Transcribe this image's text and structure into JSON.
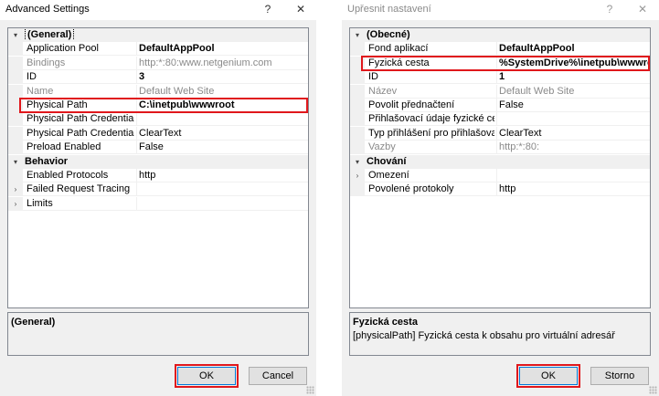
{
  "left": {
    "title": "Advanced Settings",
    "help": "?",
    "close": "✕",
    "rows": [
      {
        "type": "cat",
        "expander": "▾",
        "name": "(General)",
        "value": "",
        "selected": true
      },
      {
        "type": "prop",
        "name": "Application Pool",
        "value": "DefaultAppPool",
        "bold": true
      },
      {
        "type": "prop",
        "name": "Bindings",
        "value": "http:*:80:www.netgenium.com",
        "dim": true
      },
      {
        "type": "prop",
        "name": "ID",
        "value": "3",
        "bold": true
      },
      {
        "type": "prop",
        "name": "Name",
        "value": "Default Web Site",
        "dim": true
      },
      {
        "type": "prop",
        "name": "Physical Path",
        "value": "C:\\inetpub\\wwwroot",
        "bold": true
      },
      {
        "type": "prop",
        "name": "Physical Path Credentials",
        "value": ""
      },
      {
        "type": "prop",
        "name": "Physical Path Credentials Logon",
        "value": "ClearText"
      },
      {
        "type": "prop",
        "name": "Preload Enabled",
        "value": "False"
      },
      {
        "type": "cat",
        "expander": "▾",
        "name": "Behavior",
        "value": ""
      },
      {
        "type": "prop",
        "name": "Enabled Protocols",
        "value": "http"
      },
      {
        "type": "prop",
        "expander": "›",
        "name": "Failed Request Tracing",
        "value": ""
      },
      {
        "type": "prop",
        "expander": "›",
        "name": "Limits",
        "value": ""
      }
    ],
    "desc_title": "(General)",
    "desc_text": "",
    "ok": "OK",
    "cancel": "Cancel"
  },
  "right": {
    "title": "Upřesnit nastavení",
    "help": "?",
    "close": "✕",
    "rows": [
      {
        "type": "cat",
        "expander": "▾",
        "name": "(Obecné)",
        "value": ""
      },
      {
        "type": "prop",
        "name": "Fond aplikací",
        "value": "DefaultAppPool",
        "bold": true
      },
      {
        "type": "prop",
        "name": "Fyzická cesta",
        "value": "%SystemDrive%\\inetpub\\wwwroot",
        "bold": true
      },
      {
        "type": "prop",
        "name": "ID",
        "value": "1",
        "bold": true
      },
      {
        "type": "prop",
        "name": "Název",
        "value": "Default Web Site",
        "dim": true
      },
      {
        "type": "prop",
        "name": "Povolit přednačtení",
        "value": "False"
      },
      {
        "type": "prop",
        "name": "Přihlašovací údaje fyzické cesty",
        "value": ""
      },
      {
        "type": "prop",
        "name": "Typ přihlášení pro přihlašovací ú",
        "value": "ClearText"
      },
      {
        "type": "prop",
        "name": "Vazby",
        "value": "http:*:80:",
        "dim": true
      },
      {
        "type": "cat",
        "expander": "▾",
        "name": "Chování",
        "value": ""
      },
      {
        "type": "prop",
        "expander": "›",
        "name": "Omezení",
        "value": ""
      },
      {
        "type": "prop",
        "name": "Povolené protokoly",
        "value": "http"
      }
    ],
    "desc_title": "Fyzická cesta",
    "desc_text": "[physicalPath] Fyzická cesta k obsahu pro virtuální adresář",
    "ok": "OK",
    "cancel": "Storno"
  },
  "colors": {
    "highlight": "#e0171c",
    "grid_border": "#828790",
    "gutter": "#f0f0f0"
  }
}
